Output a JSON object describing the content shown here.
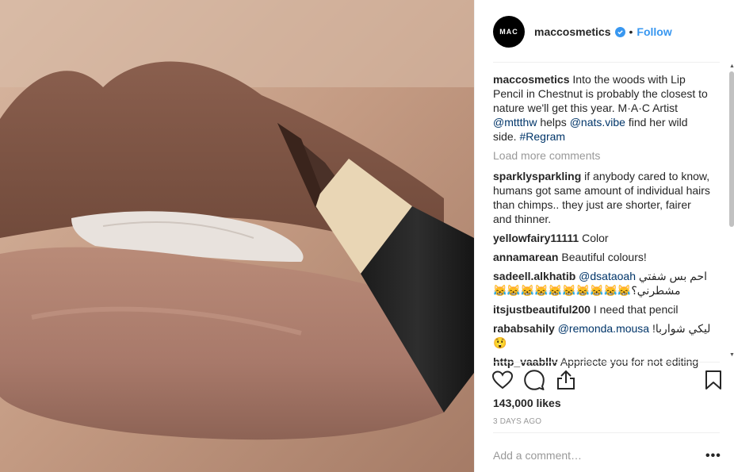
{
  "post": {
    "image_alt": "Lips with brown lip pencil",
    "author": {
      "username": "maccosmetics",
      "avatar_text": "MAC",
      "follow_label": "Follow",
      "separator": "•"
    },
    "caption": {
      "username": "maccosmetics",
      "text_1": "Into the woods with Lip Pencil in Chestnut is probably the closest to nature we'll get this year. M·A·C Artist ",
      "mention_1": "@mttthw",
      "text_2": " helps ",
      "mention_2": "@nats.vibe",
      "text_3": " find her wild side. ",
      "hashtag": "#Regram"
    },
    "load_more_label": "Load more comments",
    "comments": [
      {
        "username": "sparklysparkling",
        "text": "if anybody cared to know, humans got same amount of individual hairs than chimps.. they just are shorter, fairer and thinner."
      },
      {
        "username": "yellowfairy11111",
        "text": "Color"
      },
      {
        "username": "annamarean",
        "text": "Beautiful colours!"
      },
      {
        "username": "sadeell.alkhatib",
        "mention": "@dsataoah",
        "text": "احم بس شفتي مشطرني؟😹😹😹😹😹😹😹😹😹😹"
      },
      {
        "username": "itsjustbeautiful200",
        "text": "I need that pencil"
      },
      {
        "username": "rababsahily",
        "mention": "@remonda.mousa",
        "text": "ليكي شواربا!😲"
      },
      {
        "username": "http_vaabllv",
        "text": "Appriecte you for not editing"
      }
    ],
    "likes": "143,000 likes",
    "timestamp": "3 DAYS AGO",
    "add_comment_placeholder": "Add a comment…",
    "more_options": "•••"
  }
}
